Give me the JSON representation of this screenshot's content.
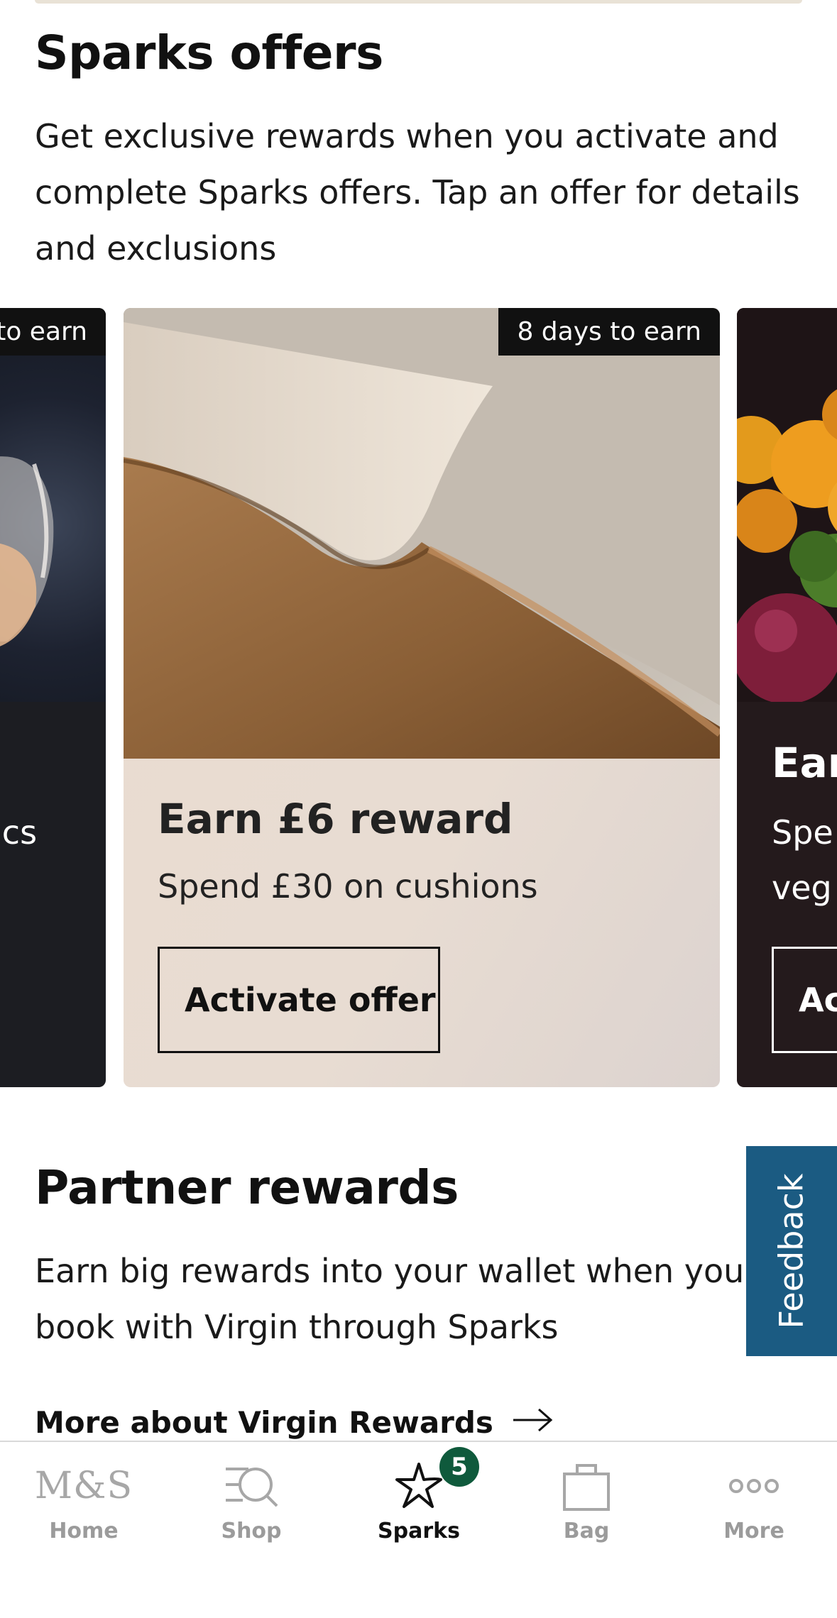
{
  "sparks_offers": {
    "title": "Sparks offers",
    "description": "Get exclusive rewards when you activate and complete Sparks offers. Tap an offer for details and exclusions"
  },
  "offers": [
    {
      "days_badge": "to earn",
      "subtitle": "ics"
    },
    {
      "days_badge": "8 days to earn",
      "title": "Earn £6 reward",
      "subtitle": "Spend £30 on cushions",
      "button": "Activate offer"
    },
    {
      "title": "Ear",
      "subtitle_line1": "Spe",
      "subtitle_line2": "veg",
      "button": "Ac"
    }
  ],
  "partner_rewards": {
    "title": "Partner rewards",
    "description_line1": "Earn big rewards into your wallet when you",
    "description_line2": "book with Virgin through Sparks",
    "link": "More about Virgin Rewards"
  },
  "feedback": {
    "label": "Feedback"
  },
  "tabbar": {
    "items": [
      {
        "label": "Home",
        "icon": "ms-logo",
        "logo_text": "M&S"
      },
      {
        "label": "Shop",
        "icon": "search-list-icon"
      },
      {
        "label": "Sparks",
        "icon": "sparks-star-icon",
        "badge": "5",
        "active": true
      },
      {
        "label": "Bag",
        "icon": "bag-icon"
      },
      {
        "label": "More",
        "icon": "more-dots-icon"
      }
    ]
  },
  "colors": {
    "accent_badge": "#0f5a3c",
    "feedback_bg": "#1b5b82",
    "card_main_bg": "#eadbd0"
  }
}
